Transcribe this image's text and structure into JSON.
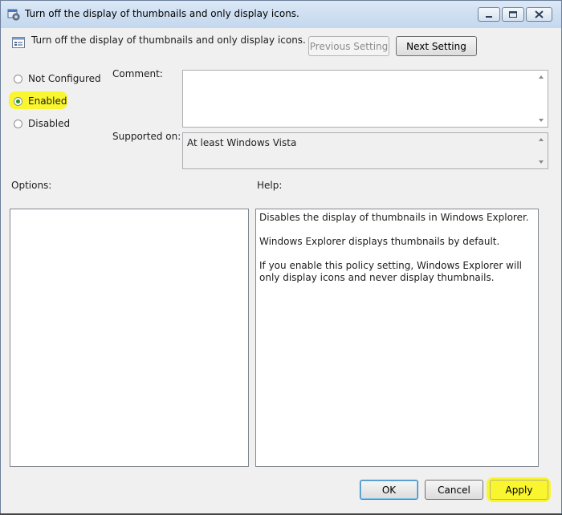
{
  "window": {
    "title": "Turn off the display of thumbnails and only display icons."
  },
  "header": {
    "policy_name": "Turn off the display of thumbnails and only display icons.",
    "previous_label": "Previous Setting",
    "next_label": "Next Setting"
  },
  "state": {
    "options": [
      {
        "label": "Not Configured",
        "checked": false
      },
      {
        "label": "Enabled",
        "checked": true
      },
      {
        "label": "Disabled",
        "checked": false
      }
    ]
  },
  "comment": {
    "label": "Comment:",
    "value": ""
  },
  "supported": {
    "label": "Supported on:",
    "value": "At least Windows Vista"
  },
  "options_panel": {
    "label": "Options:"
  },
  "help": {
    "label": "Help:",
    "paragraphs": [
      "Disables the display of thumbnails in Windows Explorer.",
      "Windows Explorer displays thumbnails by default.",
      "If you enable this policy setting, Windows Explorer will only display icons and never display thumbnails."
    ]
  },
  "footer": {
    "ok_label": "OK",
    "cancel_label": "Cancel",
    "apply_label": "Apply"
  },
  "colors": {
    "highlight": "#f9f52f",
    "radio_selected": "#1f9a1f"
  },
  "icons": {
    "title": "policy-app-icon",
    "policy": "policy-setting-icon"
  }
}
